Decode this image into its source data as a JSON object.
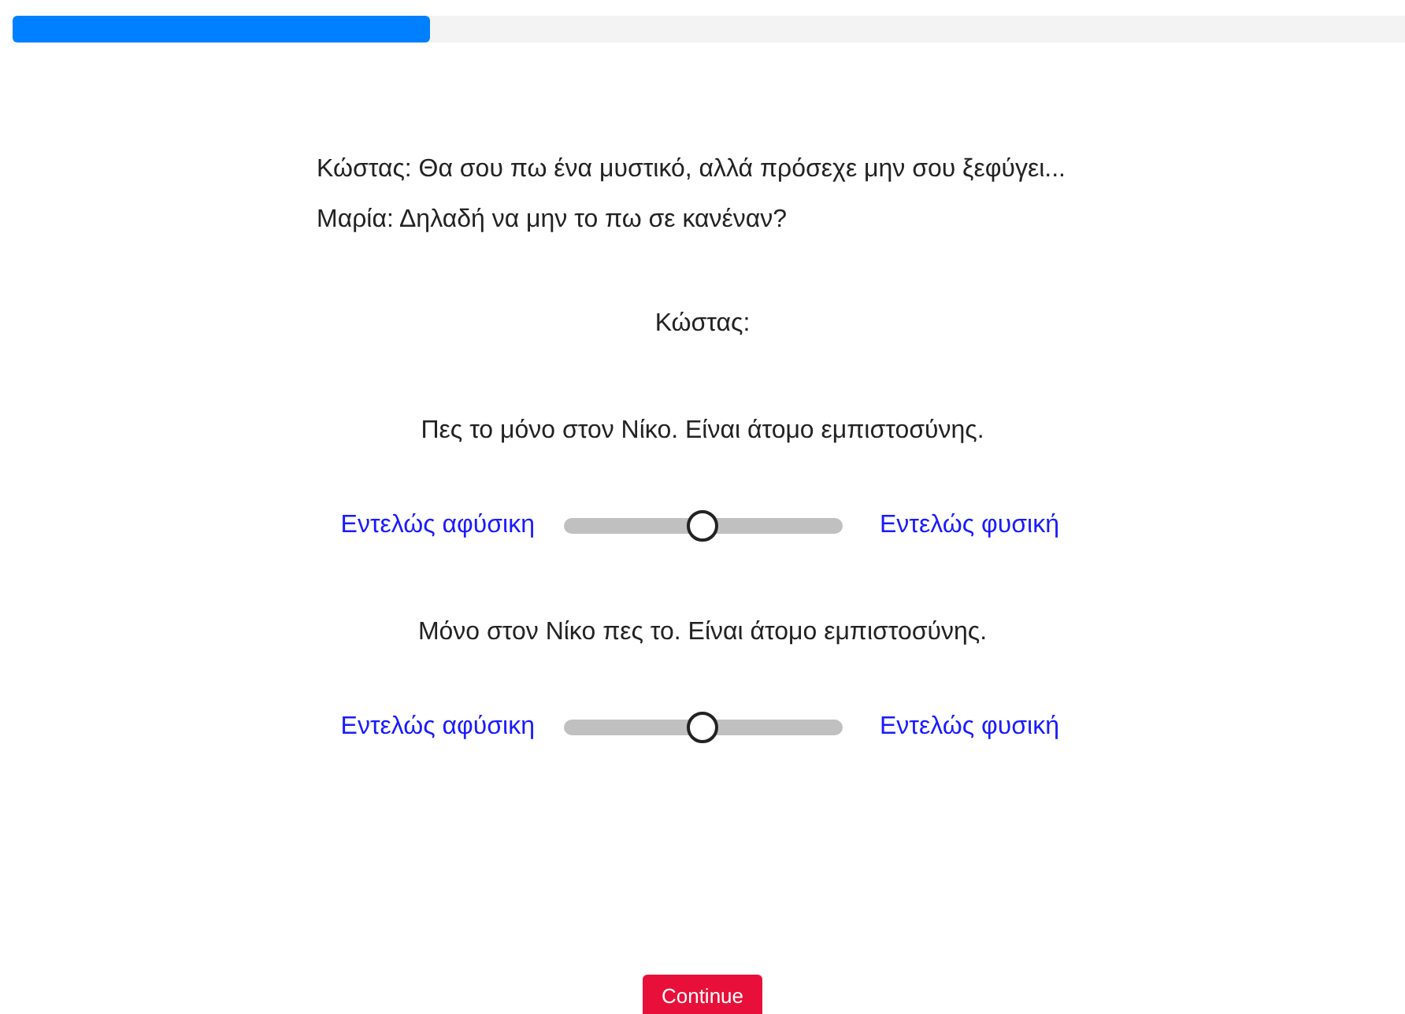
{
  "progress": {
    "level": 0.3
  },
  "dialogue": [
    "Κώστας: Θα σου πω ένα μυστικό, αλλά πρόσεχε μην σου ξεφύγει...",
    "Μαρία: Δηλαδή να μην το πω σε κανέναν?"
  ],
  "speaker": "Κώστας:",
  "items": [
    {
      "sentence": "Πες το μόνο στον Νίκο. Είναι άτομο εμπιστοσύνης.",
      "left_label": "Εντελώς αφύσικη",
      "right_label": "Εντελώς φυσική",
      "level": 0.5
    },
    {
      "sentence": "Μόνο στον Νίκο πες το. Είναι άτομο εμπιστοσύνης.",
      "left_label": "Εντελώς αφύσικη",
      "right_label": "Εντελώς φυσική",
      "level": 0.5
    }
  ],
  "button": "Continue"
}
